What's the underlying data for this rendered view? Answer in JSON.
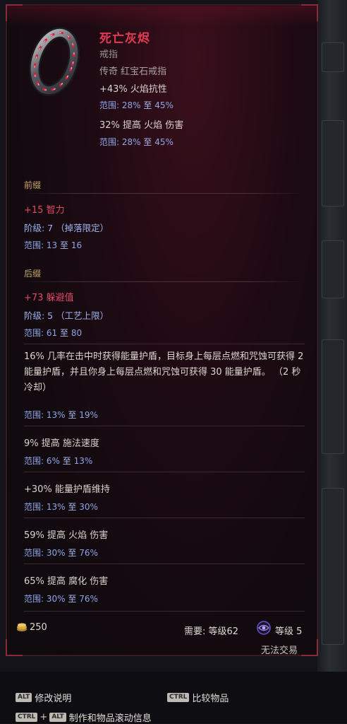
{
  "item": {
    "name": "死亡灰烬",
    "type": "戒指",
    "rarity": "传奇 红宝石戒指",
    "implicits": [
      {
        "text": "+43% 火焰抗性",
        "range_label": "范围",
        "range_min": "28%",
        "range_to": "至",
        "range_max": "45%"
      },
      {
        "text": "32% 提高 火焰 伤害",
        "range_label": "范围",
        "range_min": "28%",
        "range_to": "至",
        "range_max": "45%"
      }
    ],
    "prefix": {
      "header": "前缀",
      "stat": "+15 智力",
      "tier": "阶级: 7 （掉落限定）",
      "range_label": "范围",
      "range_min": "13",
      "range_to": "至",
      "range_max": "16"
    },
    "suffix": {
      "header": "后缀",
      "stat": "+73 躲避值",
      "tier": "阶级: 5 （工艺上限）",
      "range_label": "范围",
      "range_min": "61",
      "range_to": "至",
      "range_max": "80"
    },
    "uniques": [
      {
        "text": "16% 几率在击中时获得能量护盾，目标身上每层点燃和咒蚀可获得 2 能量护盾，并且你身上每层点燃和咒蚀可获得 30 能量护盾。 （2 秒冷却）",
        "range_label": "范围",
        "range_min": "13%",
        "range_to": "至",
        "range_max": "19%"
      },
      {
        "text": "9% 提高 施法速度",
        "range_label": "范围",
        "range_min": "6%",
        "range_to": "至",
        "range_max": "13%"
      },
      {
        "text": "+30% 能量护盾维持",
        "range_label": "范围",
        "range_min": "13%",
        "range_to": "至",
        "range_max": "30%"
      },
      {
        "text": "59% 提高 火焰 伤害",
        "range_label": "范围",
        "range_min": "30%",
        "range_to": "至",
        "range_max": "76%"
      },
      {
        "text": "65% 提高 腐化 伤害",
        "range_label": "范围",
        "range_min": "30%",
        "range_to": "至",
        "range_max": "76%"
      }
    ],
    "footer": {
      "gold": "250",
      "requirement": "需要: 等级62",
      "faction_level": "等级 5",
      "trade": "无法交易"
    }
  },
  "controls": {
    "alt_key": "ALT",
    "alt_label": "修改说明",
    "ctrl_key": "CTRL",
    "ctrl_label": "比较物品",
    "combo_ctrl": "CTRL",
    "combo_plus": "+",
    "combo_alt": "ALT",
    "combo_label": "制作和物品滚动信息"
  },
  "colors": {
    "name": "#e23a55",
    "affix": "#e04a66",
    "range": "#8fa6e8",
    "section_header": "#c9a86a"
  }
}
